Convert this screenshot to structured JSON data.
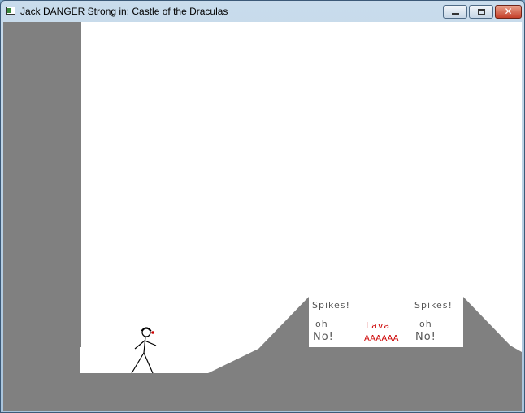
{
  "window": {
    "title": "Jack DANGER Strong in: Castle of the Draculas",
    "close_glyph": "✕"
  },
  "scene": {
    "colors": {
      "ground": "#808080",
      "sky": "#ffffff",
      "lava_text": "#cc0000",
      "sign_text": "#555555"
    },
    "labels": {
      "spikes_left": "Spikes!",
      "spikes_right": "Spikes!",
      "oh_left": "oh",
      "no_left": "No!",
      "lava": "Lava",
      "lava_scream": "AAAAAA",
      "oh_right": "oh",
      "no_right": "No!"
    }
  }
}
